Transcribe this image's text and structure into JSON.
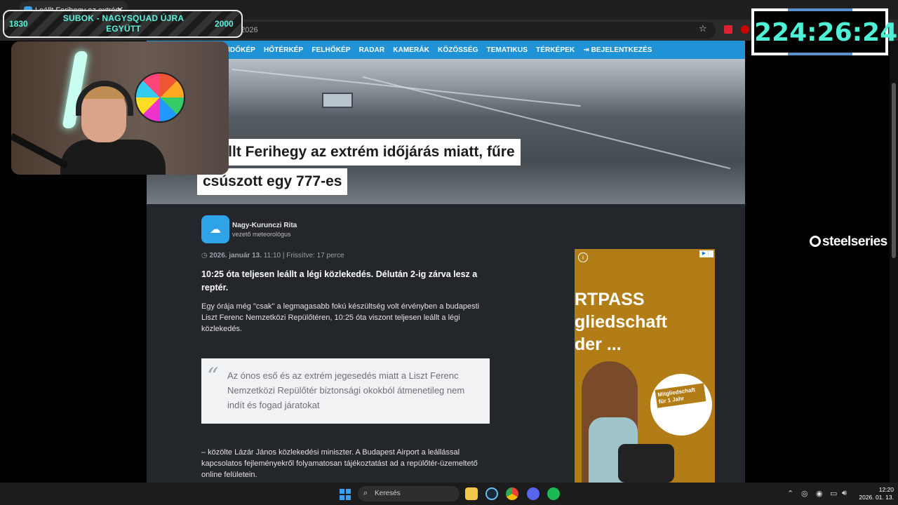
{
  "browser": {
    "tab_title": "Leállt Ferihegy az extrém időjár",
    "url_tail": "-miatt-2026"
  },
  "nav": {
    "items": [
      "IDŐKÉP",
      "HŐTÉRKÉP",
      "FELHŐKÉP",
      "RADAR",
      "KAMERÁK",
      "KÖZÖSSÉG",
      "TEMATIKUS",
      "TÉRKÉPEK"
    ],
    "login": "BEJELENTKEZÉS"
  },
  "article": {
    "headline_line1": "Leállt Ferihegy az extrém időjárás miatt, fűre",
    "headline_line2": "csúszott egy 777-es",
    "author_name": "Nagy-Kurunczi Rita",
    "author_role": "vezető meteorológus",
    "date": "2026. január 13.",
    "time": "11:10",
    "updated": "Frissítve: 17 perce",
    "lead": "10:25 óta teljesen leállt a légi közlekedés. Délután 2-ig zárva lesz a reptér.",
    "paragraph1": "Egy órája még \"csak\" a legmagasabb fokú készültség volt érvényben a budapesti Liszt Ferenc Nemzetközi Repülőtéren, 10:25 óta viszont teljesen leállt a légi közlekedés.",
    "quote": "Az ónos eső és az extrém jegesedés miatt a Liszt Ferenc Nemzetközi Repülőtér biztonsági okokból átmenetileg nem indít és fogad járatokat",
    "paragraph2": "– közölte Lázár János közlekedési miniszter. A Budapest Airport a leállással kapcsolatos fejleményekről folyamatosan tájékoztatást ad a repülőtér-üzemeltető online felületein."
  },
  "ad": {
    "line1": "RTPASS",
    "line2": "gliedschaft",
    "line3": "der ...",
    "badge": "Mitgliedschaft für 1 Jahr"
  },
  "overlay": {
    "subgoal_left": "1830",
    "subgoal_title": "SUBOK - NAGYSQUAD ÚJRA EGYÜTT",
    "subgoal_right": "2000",
    "timer": "224:26:24",
    "sponsor": "steelseries"
  },
  "taskbar": {
    "search_placeholder": "Keresés",
    "clock_time": "12:20",
    "clock_date": "2026. 01. 13."
  }
}
